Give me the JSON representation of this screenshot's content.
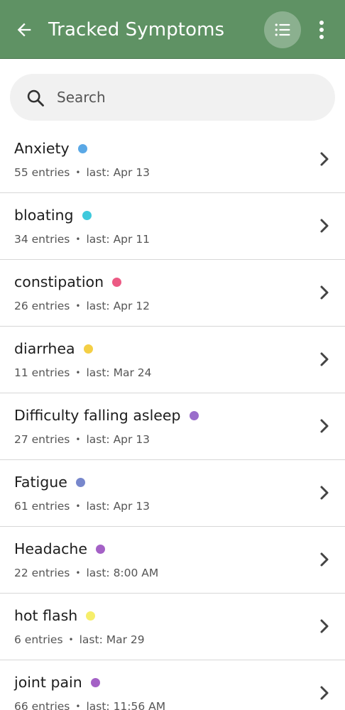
{
  "header": {
    "title": "Tracked Symptoms",
    "back_icon": "arrow-left-icon",
    "list_view_icon": "list-icon",
    "more_icon": "more-vert-icon"
  },
  "search": {
    "placeholder": "Search",
    "value": ""
  },
  "symptoms": [
    {
      "name": "Anxiety",
      "color": "#5aa8e6",
      "entries": "55 entries",
      "last": "last: Apr 13"
    },
    {
      "name": "bloating",
      "color": "#3ec9dc",
      "entries": "34 entries",
      "last": "last: Apr 11"
    },
    {
      "name": "constipation",
      "color": "#ec5a84",
      "entries": "26 entries",
      "last": "last: Apr 12"
    },
    {
      "name": "diarrhea",
      "color": "#f4cf45",
      "entries": "11 entries",
      "last": "last: Mar 24"
    },
    {
      "name": "Difficulty falling asleep",
      "color": "#9a6ecb",
      "entries": "27 entries",
      "last": "last: Apr 13"
    },
    {
      "name": "Fatigue",
      "color": "#7787cc",
      "entries": "61 entries",
      "last": "last: Apr 13"
    },
    {
      "name": "Headache",
      "color": "#a461c6",
      "entries": "22 entries",
      "last": "last: 8:00 AM"
    },
    {
      "name": "hot flash",
      "color": "#f6ee6a",
      "entries": "6 entries",
      "last": "last: Mar 29"
    },
    {
      "name": "joint pain",
      "color": "#a461c6",
      "entries": "66 entries",
      "last": "last: 11:56 AM"
    }
  ],
  "separator": "•",
  "colors": {
    "appbar": "#5f9264",
    "search_bg": "#f1f1f1",
    "divider": "#d7d7d7"
  }
}
